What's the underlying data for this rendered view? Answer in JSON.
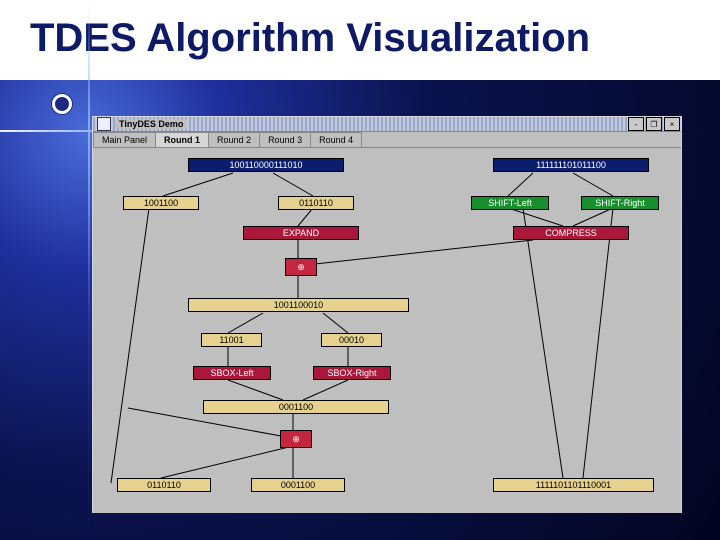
{
  "title": "TDES Algorithm Visualization",
  "window_title": "TinyDES Demo",
  "tabs": [
    {
      "label": "Main Panel",
      "active": false
    },
    {
      "label": "Round 1",
      "active": true
    },
    {
      "label": "Round 2",
      "active": false
    },
    {
      "label": "Round 3",
      "active": false
    },
    {
      "label": "Round 4",
      "active": false
    }
  ],
  "win_buttons": {
    "min": "‐",
    "max": "❐",
    "close": "×"
  },
  "nodes": {
    "input_bits": "100110000111010",
    "key_bits": "111111101011100",
    "left_half": "1001100",
    "right_half": "0110110",
    "shift_left": "SHIFT-Left",
    "shift_right": "SHIFT-Right",
    "expand": "EXPAND",
    "compress": "COMPRESS",
    "xor1": "⊕",
    "xor1_out": "1001100010",
    "sbox_in_left": "11001",
    "sbox_in_right": "00010",
    "sbox_left": "SBOX-Left",
    "sbox_right": "SBOX-Right",
    "sbox_out": "0001100",
    "xor2": "⊕",
    "out_left": "0110110",
    "out_right": "0001100",
    "next_key": "1111101101110001"
  },
  "colors": {
    "navy": "#0b1e6e",
    "gold": "#e6d28e",
    "crimson": "#a9173a",
    "red": "#c4253f",
    "green": "#1a8f2e"
  }
}
